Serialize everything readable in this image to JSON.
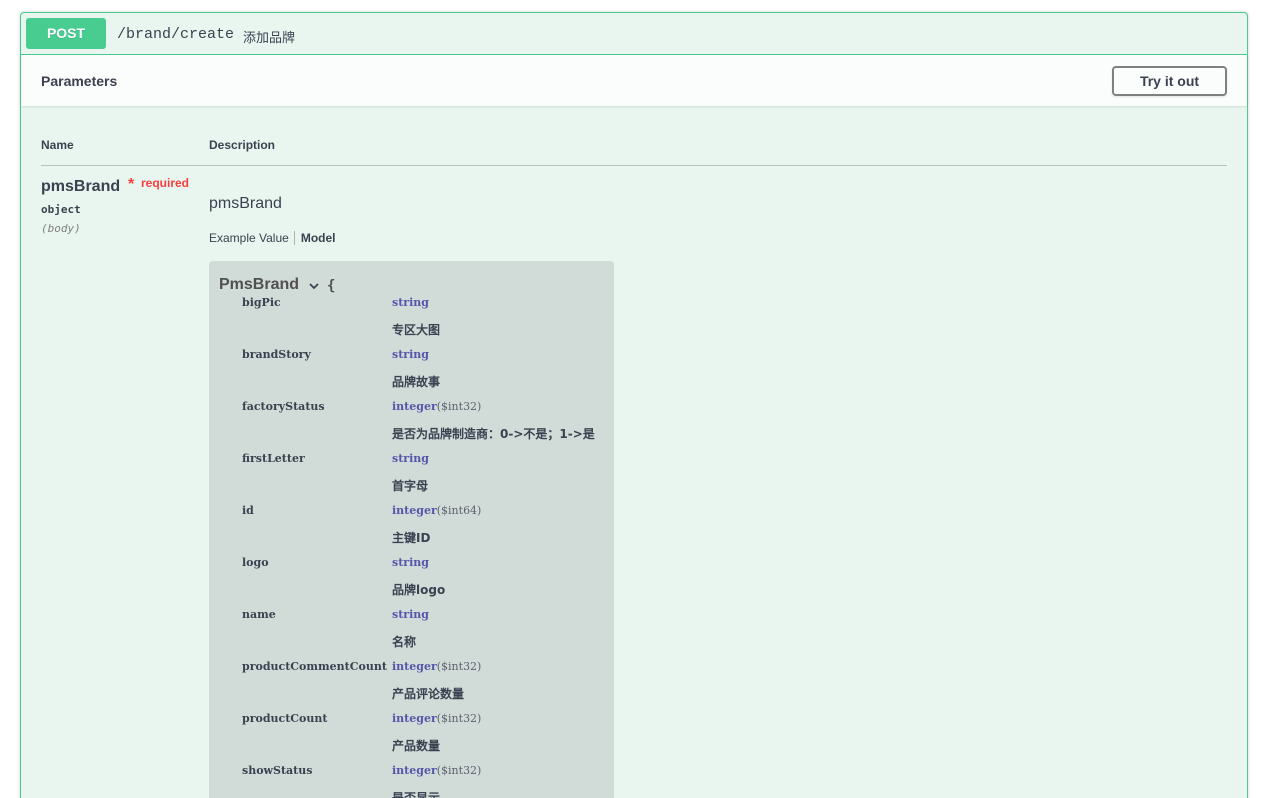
{
  "operation": {
    "method": "POST",
    "path": "/brand/create",
    "summary": "添加品牌"
  },
  "parameters_section": {
    "title": "Parameters",
    "try_button": "Try it out",
    "columns": {
      "name": "Name",
      "description": "Description"
    }
  },
  "param": {
    "name": "pmsBrand",
    "required_star": "*",
    "required_label": "required",
    "type": "object",
    "in": "(body)",
    "description": "pmsBrand",
    "tabs": {
      "example": "Example Value",
      "model": "Model"
    }
  },
  "model": {
    "title": "PmsBrand",
    "open_brace": "{",
    "properties": [
      {
        "name": "bigPic",
        "type": "string",
        "format": "",
        "desc": "专区大图"
      },
      {
        "name": "brandStory",
        "type": "string",
        "format": "",
        "desc": "品牌故事"
      },
      {
        "name": "factoryStatus",
        "type": "integer",
        "format": "($int32)",
        "desc": "是否为品牌制造商：0->不是；1->是"
      },
      {
        "name": "firstLetter",
        "type": "string",
        "format": "",
        "desc": "首字母"
      },
      {
        "name": "id",
        "type": "integer",
        "format": "($int64)",
        "desc": "主键ID"
      },
      {
        "name": "logo",
        "type": "string",
        "format": "",
        "desc": "品牌logo"
      },
      {
        "name": "name",
        "type": "string",
        "format": "",
        "desc": "名称"
      },
      {
        "name": "productCommentCount",
        "type": "integer",
        "format": "($int32)",
        "desc": "产品评论数量"
      },
      {
        "name": "productCount",
        "type": "integer",
        "format": "($int32)",
        "desc": "产品数量"
      },
      {
        "name": "showStatus",
        "type": "integer",
        "format": "($int32)",
        "desc": "是否显示"
      }
    ]
  },
  "colors": {
    "post": "#49cc90",
    "post_bg": "#e8f6ef",
    "required": "#f93e3e",
    "type_text": "#5555aa"
  }
}
